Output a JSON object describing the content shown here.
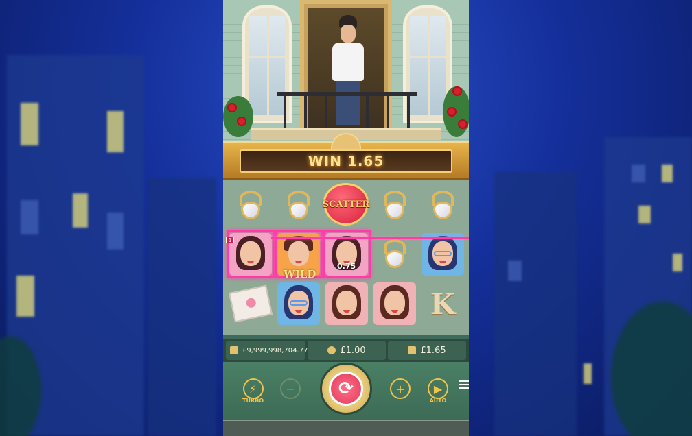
{
  "banner": {
    "win_text": "WIN 1.65"
  },
  "reels": {
    "scatter_text": "SCATTER",
    "wild_text": "WILD",
    "multiplier_text": "0.75",
    "letter_symbol": "K",
    "line_badge": "1"
  },
  "info_bar": {
    "balance": "£9,999,998,704.77",
    "bet": "£1.00",
    "win": "£1.65"
  },
  "controls": {
    "turbo_label": "TURBO",
    "auto_label": "AUTO",
    "minus_symbol": "−",
    "plus_symbol": "+",
    "spin_symbol": "⟳"
  },
  "colors": {
    "highlight": "#ff3ba6",
    "gold": "#f2c24a",
    "background": "#142f9a"
  }
}
